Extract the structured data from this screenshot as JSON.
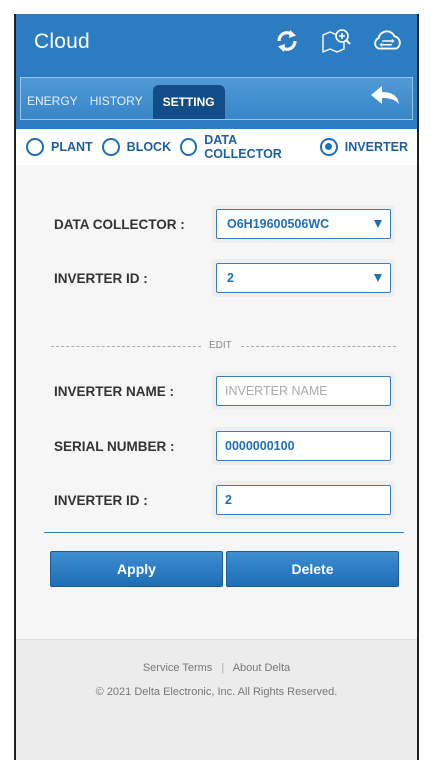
{
  "app": {
    "title": "Cloud"
  },
  "icons": {
    "refresh": "refresh-icon",
    "map_search": "map-search-icon",
    "cloud_sync": "cloud-sync-icon",
    "back": "back-arrow-icon"
  },
  "tabs": [
    {
      "label": "ENERGY",
      "active": false
    },
    {
      "label": "HISTORY",
      "active": false
    },
    {
      "label": "SETTING",
      "active": true
    }
  ],
  "radios": [
    {
      "label": "PLANT",
      "selected": false
    },
    {
      "label": "BLOCK",
      "selected": false
    },
    {
      "label": "DATA COLLECTOR",
      "selected": false
    },
    {
      "label": "INVERTER",
      "selected": true
    }
  ],
  "form": {
    "data_collector": {
      "label": "DATA COLLECTOR :",
      "value": "O6H19600506WC"
    },
    "inverter_id_select": {
      "label": "INVERTER ID :",
      "value": "2"
    },
    "edit_label": "EDIT",
    "inverter_name": {
      "label": "INVERTER NAME :",
      "value": "",
      "placeholder": "INVERTER NAME"
    },
    "serial_number": {
      "label": "SERIAL NUMBER :",
      "value": "0000000100"
    },
    "inverter_id_input": {
      "label": "INVERTER ID :",
      "value": "2"
    }
  },
  "buttons": {
    "apply": "Apply",
    "delete": "Delete"
  },
  "footer": {
    "service_terms": "Service Terms",
    "separator": "|",
    "about": "About Delta",
    "copyright": "© 2021 Delta Electronic, Inc. All Rights Reserved."
  },
  "colors": {
    "primary": "#2c7cc1",
    "tab_active": "#134d88",
    "accent_text": "#1e6fb5"
  }
}
